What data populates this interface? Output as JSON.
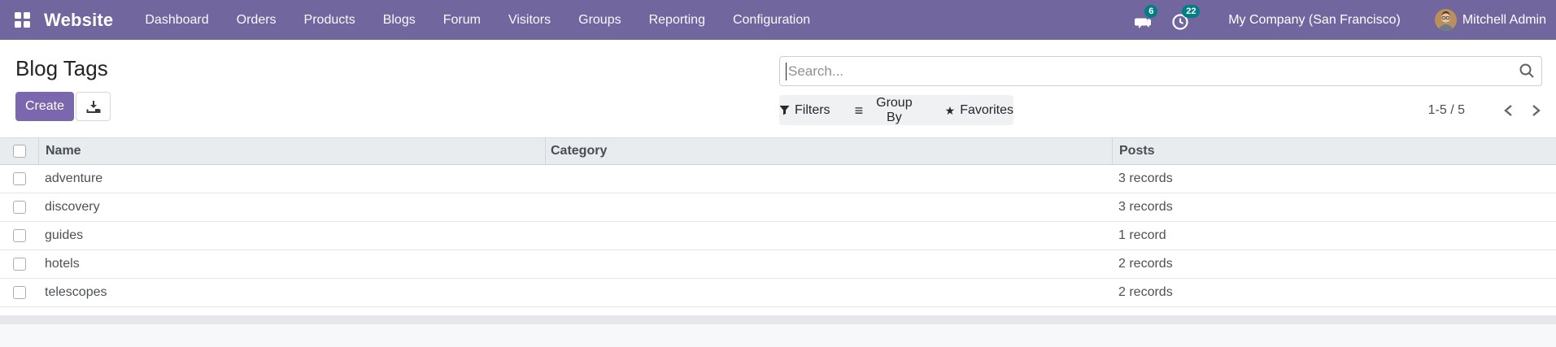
{
  "navbar": {
    "brand": "Website",
    "items": [
      "Dashboard",
      "Orders",
      "Products",
      "Blogs",
      "Forum",
      "Visitors",
      "Groups",
      "Reporting",
      "Configuration"
    ],
    "messages_badge": "6",
    "activities_badge": "22",
    "company": "My Company (San Francisco)",
    "user": "Mitchell Admin"
  },
  "control_panel": {
    "title": "Blog Tags",
    "create_label": "Create",
    "search_placeholder": "Search...",
    "filters_label": "Filters",
    "group_by_label": "Group By",
    "favorites_label": "Favorites",
    "pager_value": "1-5 / 5"
  },
  "table": {
    "columns": {
      "name": "Name",
      "category": "Category",
      "posts": "Posts"
    },
    "rows": [
      {
        "name": "adventure",
        "category": "",
        "posts": "3 records"
      },
      {
        "name": "discovery",
        "category": "",
        "posts": "3 records"
      },
      {
        "name": "guides",
        "category": "",
        "posts": "1 record"
      },
      {
        "name": "hotels",
        "category": "",
        "posts": "2 records"
      },
      {
        "name": "telescopes",
        "category": "",
        "posts": "2 records"
      }
    ]
  },
  "icons": {
    "apps": "grid-2x2",
    "messages": "chat-bubbles",
    "activities": "clock",
    "export": "download-tray",
    "search": "magnifier",
    "filters": "funnel",
    "group_by_glyph": "≡",
    "favorites_glyph": "★",
    "pager_prev": "chevron-left",
    "pager_next": "chevron-right"
  },
  "colors": {
    "navbar": "#71669e",
    "primary_button": "#7b67ad",
    "badge": "#017e84",
    "header_bg": "#e9ecef"
  }
}
